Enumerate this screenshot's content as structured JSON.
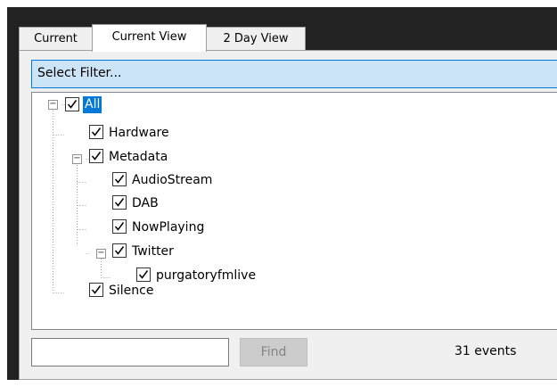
{
  "tabs": [
    {
      "label": "Current"
    },
    {
      "label": "Current View"
    },
    {
      "label": "2 Day View"
    }
  ],
  "filter": {
    "label": "Select Filter..."
  },
  "tree": {
    "nodes": [
      {
        "label": "All",
        "checked": true,
        "expanded": true,
        "selected": true
      },
      {
        "label": "Hardware",
        "checked": true
      },
      {
        "label": "Metadata",
        "checked": true,
        "expanded": true
      },
      {
        "label": "AudioStream",
        "checked": true
      },
      {
        "label": "DAB",
        "checked": true
      },
      {
        "label": "NowPlaying",
        "checked": true
      },
      {
        "label": "Twitter",
        "checked": true,
        "expanded": true
      },
      {
        "label": "purgatoryfmlive",
        "checked": true
      },
      {
        "label": "Silence",
        "checked": true
      }
    ]
  },
  "search": {
    "value": "",
    "placeholder": ""
  },
  "find_button": {
    "label": "Find",
    "enabled": false
  },
  "event_count": "31 events",
  "colors": {
    "accent": "#0078d7",
    "filter_bg": "#cce4f7",
    "frame_bg": "#222222"
  }
}
